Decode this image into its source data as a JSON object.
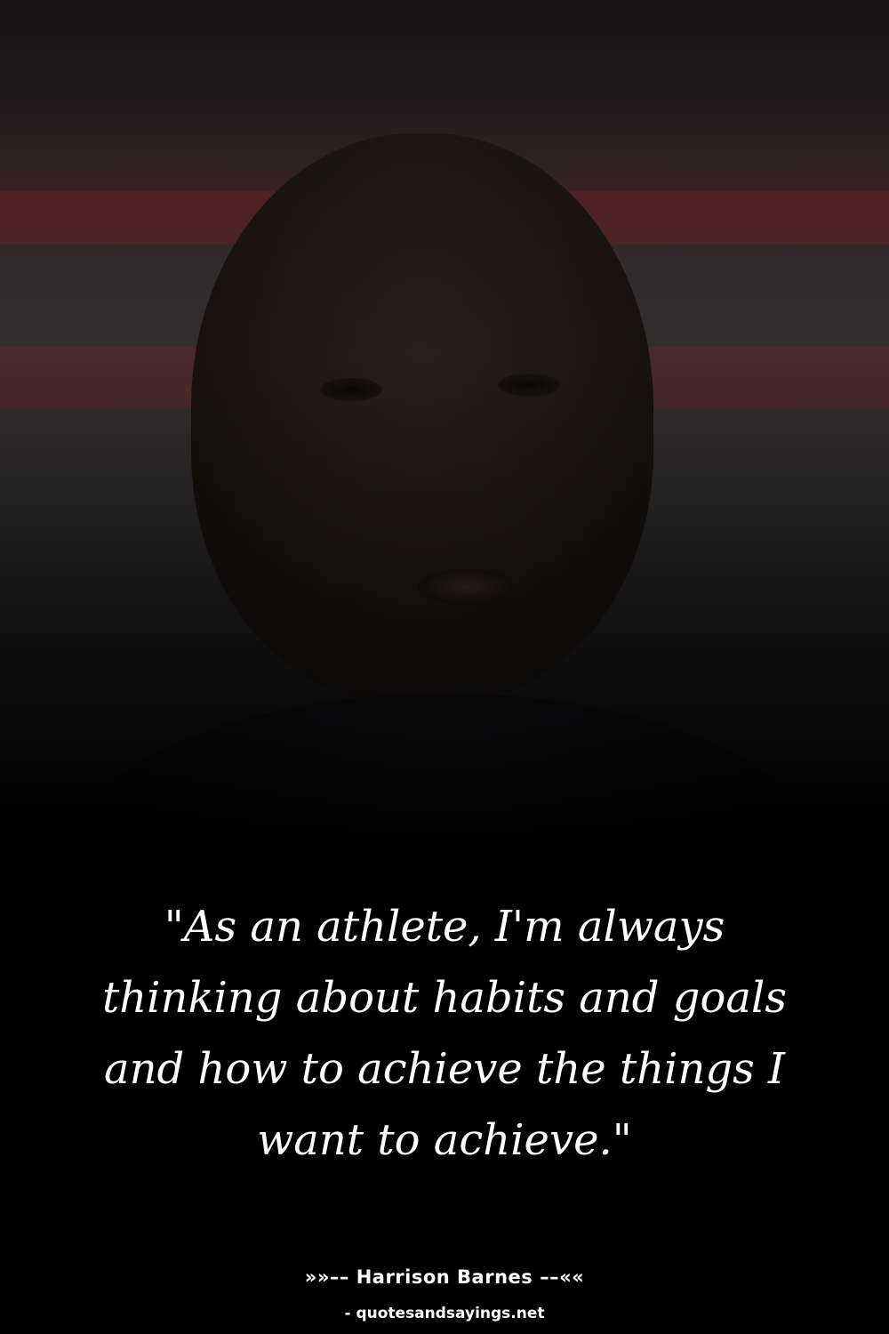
{
  "photo": {
    "subject": "portrait-photo",
    "accent_color": "#7a2a2e"
  },
  "quote": {
    "text": "\"As an athlete, I'm always thinking about habits and goals and how to achieve the things I want to achieve.\""
  },
  "attribution": {
    "author_line": "»»–– Harrison Barnes ––««",
    "source": "- quotesandsayings.net"
  }
}
